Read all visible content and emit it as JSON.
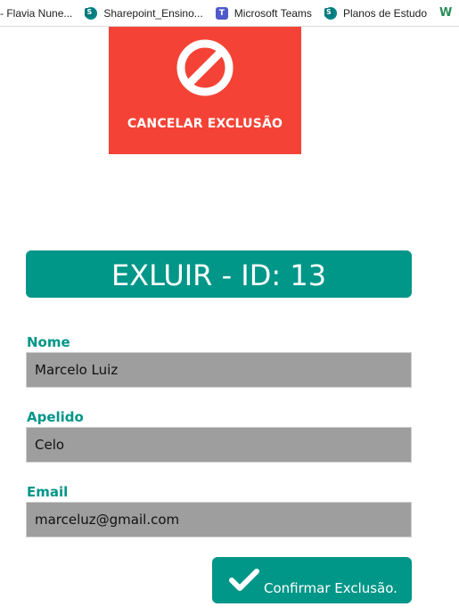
{
  "bookmarks": [
    {
      "label": "- Flavia Nune...",
      "icon": "none"
    },
    {
      "label": "Sharepoint_Ensino...",
      "icon": "sharepoint-icon"
    },
    {
      "label": "Microsoft Teams",
      "icon": "teams-icon"
    },
    {
      "label": "Planos de Estudo",
      "icon": "sharepoint-icon"
    },
    {
      "label": "",
      "icon": "w-icon"
    }
  ],
  "cancel": {
    "label": "CANCELAR EXCLUSÃO",
    "icon": "prohibited-icon",
    "color": "#f44336"
  },
  "title": "EXLUIR - ID: 13",
  "form": {
    "nome": {
      "label": "Nome",
      "value": "Marcelo Luiz"
    },
    "apelido": {
      "label": "Apelido",
      "value": "Celo"
    },
    "email": {
      "label": "Email",
      "value": "marceluz@gmail.com"
    }
  },
  "confirm": {
    "label": "Confirmar Exclusão.",
    "icon": "checkmark-icon",
    "color": "#009688"
  },
  "colors": {
    "accent": "#009688",
    "danger": "#f44336",
    "input_bg": "#9e9e9e"
  }
}
